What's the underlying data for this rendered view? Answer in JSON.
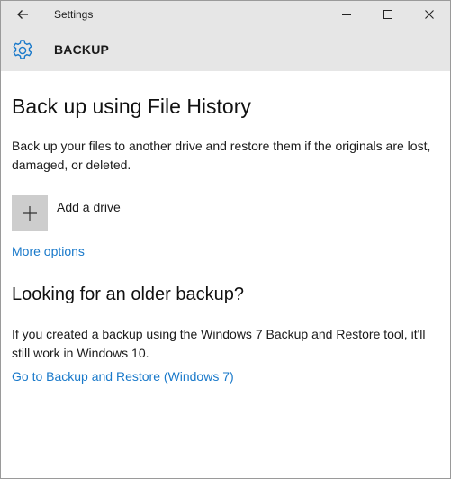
{
  "window": {
    "title": "Settings"
  },
  "header": {
    "title": "BACKUP",
    "icon": "gear-icon"
  },
  "file_history": {
    "heading": "Back up using File History",
    "description": "Back up your files to another drive and restore them if the originals are lost, damaged, or deleted.",
    "add_drive_label": "Add a drive",
    "more_options_label": "More options"
  },
  "older_backup": {
    "heading": "Looking for an older backup?",
    "description": "If you created a backup using the Windows 7 Backup and Restore tool, it'll still work in Windows 10.",
    "link_label": "Go to Backup and Restore (Windows 7)"
  },
  "colors": {
    "link": "#1979ca",
    "accent": "#1979ca",
    "titlebar_bg": "#e6e6e6",
    "tile_bg": "#cdcdcd"
  }
}
